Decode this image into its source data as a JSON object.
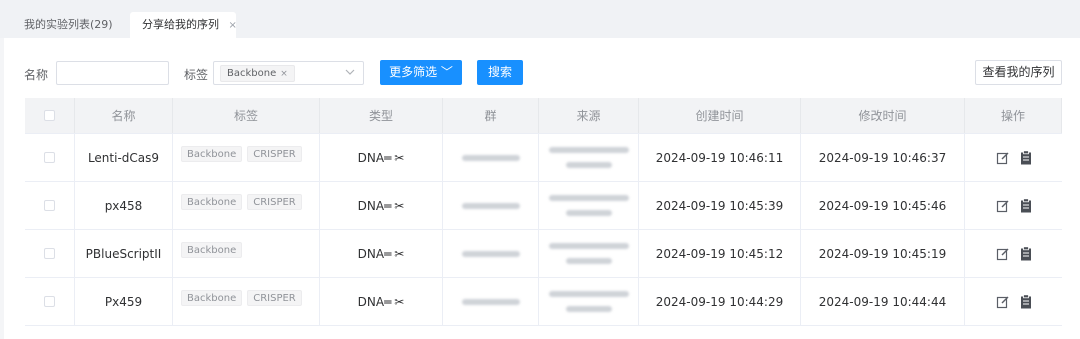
{
  "tabs": [
    {
      "label": "我的实验列表(29)",
      "active": false
    },
    {
      "label": "分享给我的序列",
      "active": true,
      "close": "×"
    }
  ],
  "filters": {
    "name_label": "名称",
    "name_value": "",
    "tag_label": "标签",
    "tag_selected": "Backbone",
    "tag_remove": "×",
    "more_filters": "更多筛选 ﹀",
    "search": "搜索",
    "view_mine": "查看我的序列"
  },
  "table": {
    "columns": [
      "名称",
      "标签",
      "类型",
      "群",
      "来源",
      "创建时间",
      "修改时间",
      "操作"
    ],
    "rows": [
      {
        "name": "Lenti-dCas9",
        "tags": [
          "Backbone",
          "CRISPER"
        ],
        "type": "DNA",
        "created": "2024-09-19 10:46:11",
        "modified": "2024-09-19 10:46:37"
      },
      {
        "name": "px458",
        "tags": [
          "Backbone",
          "CRISPER"
        ],
        "type": "DNA",
        "created": "2024-09-19 10:45:39",
        "modified": "2024-09-19 10:45:46"
      },
      {
        "name": "PBlueScriptII",
        "tags": [
          "Backbone"
        ],
        "type": "DNA",
        "created": "2024-09-19 10:45:12",
        "modified": "2024-09-19 10:45:19"
      },
      {
        "name": "Px459",
        "tags": [
          "Backbone",
          "CRISPER"
        ],
        "type": "DNA",
        "created": "2024-09-19 10:44:29",
        "modified": "2024-09-19 10:44:44"
      }
    ]
  },
  "colors": {
    "primary": "#1890ff",
    "header_bg": "#f2f3f5",
    "tabbar_bg": "#f0f2f5"
  },
  "icons": [
    "close-icon",
    "chevron-down-icon",
    "linear-icon",
    "scissors-icon",
    "edit-icon",
    "clipboard-icon"
  ]
}
